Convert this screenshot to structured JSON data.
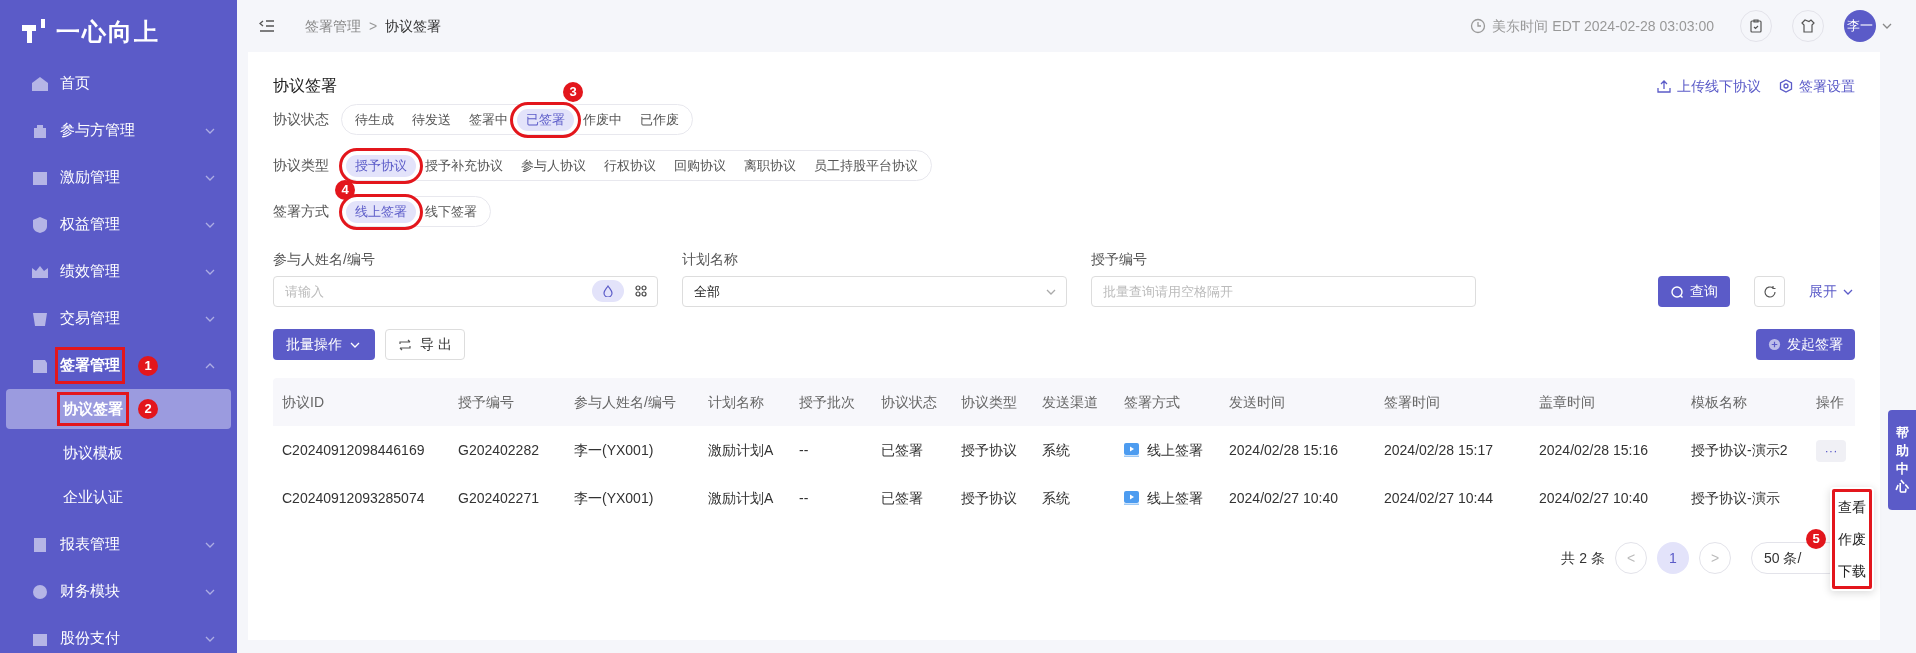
{
  "logo": {
    "text": "一心向上"
  },
  "sidebar": {
    "items": [
      {
        "label": "首页",
        "expandable": false,
        "expanded": false,
        "marked": false
      },
      {
        "label": "参与方管理",
        "expandable": true,
        "expanded": false,
        "marked": false
      },
      {
        "label": "激励管理",
        "expandable": true,
        "expanded": false,
        "marked": false
      },
      {
        "label": "权益管理",
        "expandable": true,
        "expanded": false,
        "marked": false
      },
      {
        "label": "绩效管理",
        "expandable": true,
        "expanded": false,
        "marked": false
      },
      {
        "label": "交易管理",
        "expandable": true,
        "expanded": false,
        "marked": false
      },
      {
        "label": "签署管理",
        "expandable": true,
        "expanded": true,
        "marked": true,
        "badge": "1",
        "children": [
          {
            "label": "协议签署",
            "selected": true,
            "marked": true,
            "badge": "2"
          },
          {
            "label": "协议模板",
            "selected": false,
            "marked": false
          },
          {
            "label": "企业认证",
            "selected": false,
            "marked": false
          }
        ]
      },
      {
        "label": "报表管理",
        "expandable": true,
        "expanded": false,
        "marked": false
      },
      {
        "label": "财务模块",
        "expandable": true,
        "expanded": false,
        "marked": false
      },
      {
        "label": "股份支付",
        "expandable": true,
        "expanded": false,
        "marked": false
      }
    ]
  },
  "header": {
    "breadcrumb": [
      "签署管理",
      "协议签署"
    ],
    "separator": ">",
    "time": "美东时间 EDT 2024-02-28 03:03:00",
    "avatar": "李一"
  },
  "page": {
    "title": "协议签署",
    "actions": [
      {
        "label": "上传线下协议",
        "kind": "upload"
      },
      {
        "label": "签署设置",
        "kind": "settings"
      }
    ]
  },
  "filters": [
    {
      "label": "协议状态",
      "badge": "3",
      "options": [
        {
          "label": "待生成",
          "selected": false,
          "marked": false
        },
        {
          "label": "待发送",
          "selected": false,
          "marked": false
        },
        {
          "label": "签署中",
          "selected": false,
          "marked": false
        },
        {
          "label": "已签署",
          "selected": true,
          "marked": true
        },
        {
          "label": "作废中",
          "selected": false,
          "marked": false
        },
        {
          "label": "已作废",
          "selected": false,
          "marked": false
        }
      ]
    },
    {
      "label": "协议类型",
      "badge": "4",
      "options": [
        {
          "label": "授予协议",
          "selected": true,
          "marked": true
        },
        {
          "label": "授予补充协议",
          "selected": false,
          "marked": false
        },
        {
          "label": "参与人协议",
          "selected": false,
          "marked": false
        },
        {
          "label": "行权协议",
          "selected": false,
          "marked": false
        },
        {
          "label": "回购协议",
          "selected": false,
          "marked": false
        },
        {
          "label": "离职协议",
          "selected": false,
          "marked": false
        },
        {
          "label": "员工持股平台协议",
          "selected": false,
          "marked": false
        }
      ]
    },
    {
      "label": "签署方式",
      "options": [
        {
          "label": "线上签署",
          "selected": true,
          "marked": true
        },
        {
          "label": "线下签署",
          "selected": false,
          "marked": false
        }
      ]
    }
  ],
  "search": {
    "fields": [
      {
        "kind": "input",
        "label": "参与人姓名/编号",
        "placeholder": "请输入"
      },
      {
        "kind": "select",
        "label": "计划名称",
        "value": "全部"
      },
      {
        "kind": "text",
        "label": "授予编号",
        "placeholder": "批量查询请用空格隔开"
      }
    ],
    "query": "查询",
    "expand": "展开"
  },
  "toolbar": {
    "batch": "批量操作",
    "export": "导 出",
    "start": "发起签署"
  },
  "table": {
    "columns": [
      "协议ID",
      "授予编号",
      "参与人姓名/编号",
      "计划名称",
      "授予批次",
      "协议状态",
      "协议类型",
      "发送渠道",
      "签署方式",
      "发送时间",
      "签署时间",
      "盖章时间",
      "模板名称",
      "操作"
    ],
    "rows": [
      [
        "C20240912098446169",
        "G202402282",
        "李一(YX001)",
        "激励计划A",
        "--",
        "已签署",
        "授予协议",
        "系统",
        "线上签署",
        "2024/02/28 15:16",
        "2024/02/28 15:17",
        "2024/02/28 15:16",
        "授予协议-演示2"
      ],
      [
        "C20240912093285074",
        "G202402271",
        "李一(YX001)",
        "激励计划A",
        "--",
        "已签署",
        "授予协议",
        "系统",
        "线上签署",
        "2024/02/27 10:40",
        "2024/02/27 10:44",
        "2024/02/27 10:40",
        "授予协议-演示"
      ]
    ],
    "more": "···"
  },
  "menu": {
    "items": [
      "查看",
      "作废",
      "下载"
    ],
    "badge": "5",
    "marked": true
  },
  "pagination": {
    "total": "共 2 条",
    "prev": "<",
    "pages": [
      {
        "label": "1",
        "selected": true
      }
    ],
    "next": ">",
    "size": "50 条/"
  },
  "help": "帮助中心"
}
